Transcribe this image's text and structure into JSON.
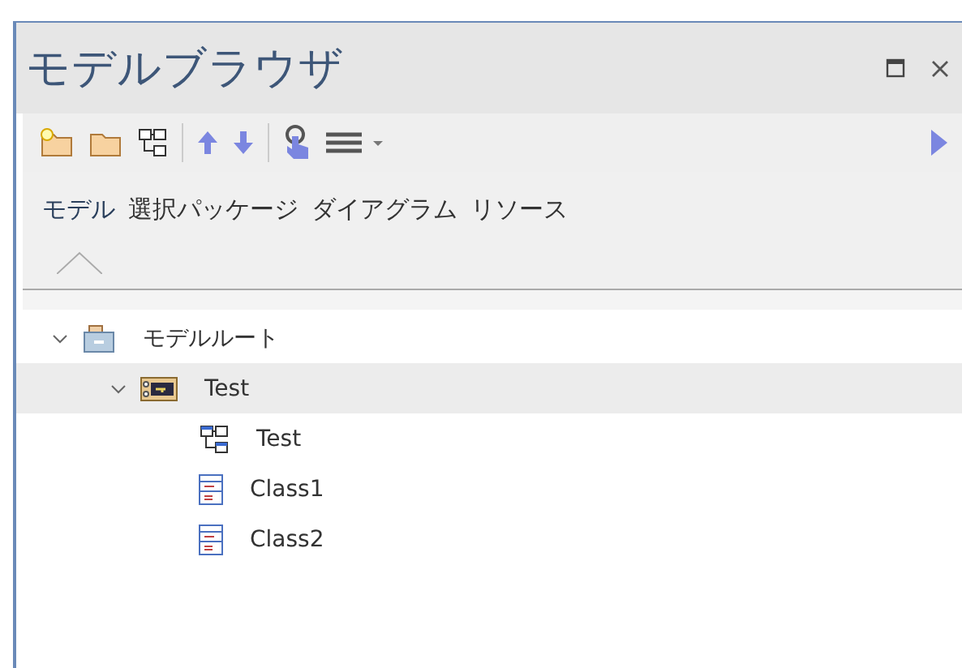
{
  "window": {
    "title": "モデルブラウザ"
  },
  "toolbar": {
    "tools": [
      {
        "kind": "new-package"
      },
      {
        "kind": "folder"
      },
      {
        "kind": "diagram"
      },
      {
        "kind": "up"
      },
      {
        "kind": "down"
      },
      {
        "kind": "hand"
      },
      {
        "kind": "menu"
      }
    ]
  },
  "tabs": [
    {
      "label": "モデル",
      "selected": true
    },
    {
      "label": "選択パッケージ",
      "selected": false
    },
    {
      "label": "ダイアグラム",
      "selected": false
    },
    {
      "label": "リソース",
      "selected": false
    }
  ],
  "tree": [
    {
      "kind": "root",
      "label": "モデルルート",
      "expanded": true,
      "selected": false,
      "children": [
        {
          "kind": "package",
          "label": "Test",
          "expanded": true,
          "selected": true,
          "children": [
            {
              "kind": "diagram",
              "label": "Test",
              "selected": false
            },
            {
              "kind": "class",
              "label": "Class1",
              "selected": false
            },
            {
              "kind": "class",
              "label": "Class2",
              "selected": false
            }
          ]
        }
      ]
    }
  ]
}
